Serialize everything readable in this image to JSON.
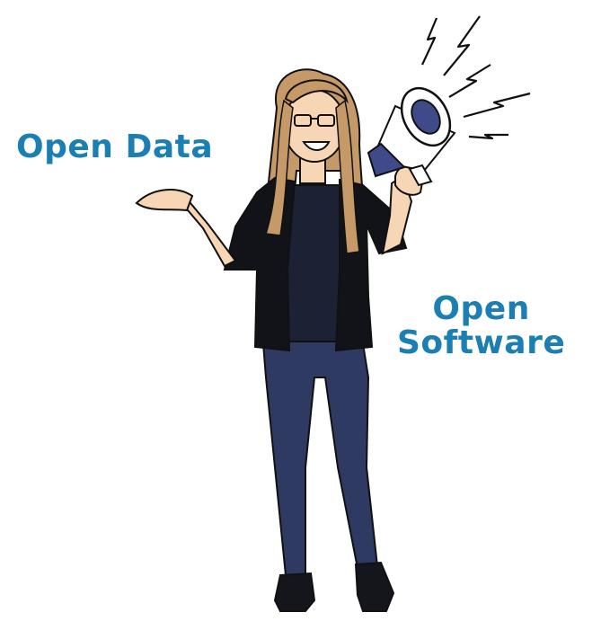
{
  "labels": {
    "open_data": "Open Data",
    "open_software_line1": "Open",
    "open_software_line2": "Software"
  },
  "colors": {
    "label_text": "#1b7fb3",
    "jacket": "#111318",
    "shirt": "#1c2233",
    "jeans": "#2f3a63",
    "hair": "#c69a68",
    "skin": "#f6d6b5",
    "megaphone_accent": "#3f4a8a",
    "outline": "#111111"
  },
  "icons": {
    "character": "woman-with-megaphone-illustration",
    "megaphone": "megaphone-icon",
    "sound_bolts": "lightning-bolt-icon"
  }
}
